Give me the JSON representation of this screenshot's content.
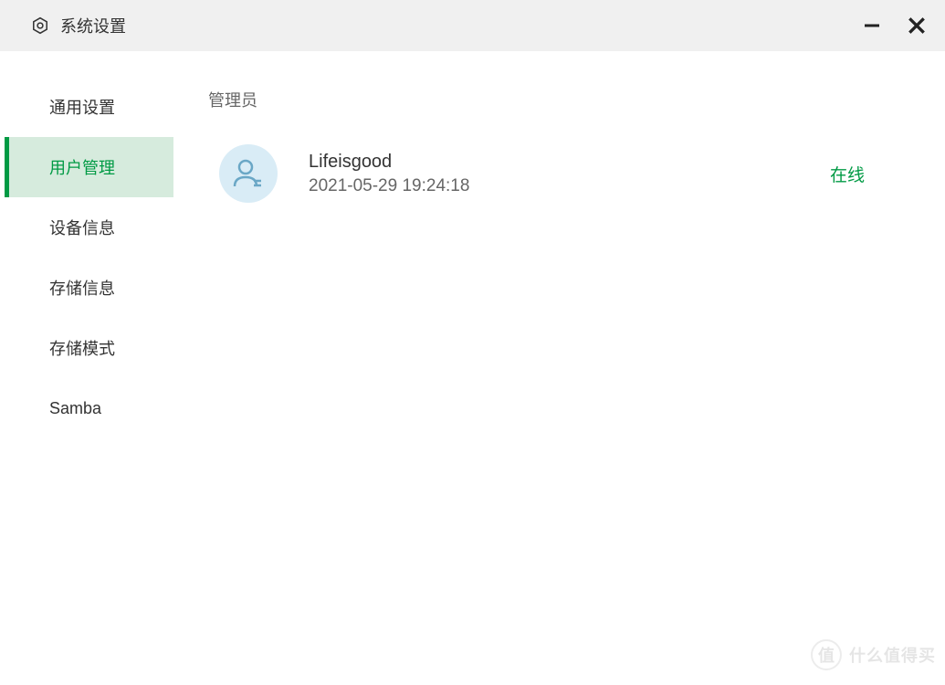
{
  "window": {
    "title": "系统设置"
  },
  "sidebar": {
    "items": [
      {
        "label": "通用设置",
        "active": false
      },
      {
        "label": "用户管理",
        "active": true
      },
      {
        "label": "设备信息",
        "active": false
      },
      {
        "label": "存储信息",
        "active": false
      },
      {
        "label": "存储模式",
        "active": false
      },
      {
        "label": "Samba",
        "active": false
      }
    ]
  },
  "content": {
    "section_title": "管理员",
    "users": [
      {
        "name": "Lifeisgood",
        "timestamp": "2021-05-29 19:24:18",
        "status": "在线"
      }
    ]
  },
  "watermark": {
    "badge": "值",
    "text": "什么值得买"
  }
}
